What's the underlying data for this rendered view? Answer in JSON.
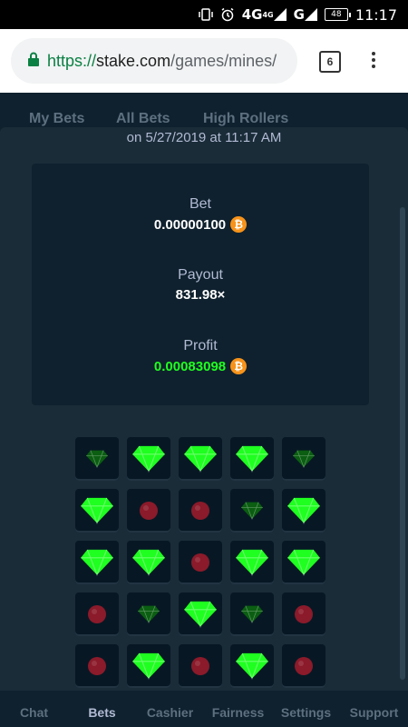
{
  "status_bar": {
    "network": "4G",
    "network_small": "4G",
    "carrier_network": "G",
    "battery": "48",
    "time": "11:17"
  },
  "browser": {
    "url_scheme": "https://",
    "url_host": "stake.com",
    "url_path": "/games/mines/",
    "tab_count": "6"
  },
  "background_tabs": [
    "My Bets",
    "All Bets",
    "High Rollers"
  ],
  "modal": {
    "date_line": "on 5/27/2019 at 11:17 AM",
    "bet_label": "Bet",
    "bet_value": "0.00000100",
    "payout_label": "Payout",
    "payout_value": "831.98×",
    "profit_label": "Profit",
    "profit_value": "0.00083098",
    "currency_symbol": "₿"
  },
  "grid": {
    "rows": [
      [
        "gem-dim",
        "gem",
        "gem",
        "gem",
        "gem-dim"
      ],
      [
        "gem",
        "mine",
        "mine",
        "gem-dim",
        "gem"
      ],
      [
        "gem",
        "gem",
        "mine",
        "gem",
        "gem"
      ],
      [
        "mine",
        "gem-dim",
        "gem",
        "gem-dim",
        "mine"
      ],
      [
        "mine",
        "gem",
        "mine",
        "gem",
        "mine"
      ]
    ]
  },
  "colors": {
    "gem": "#1fff20",
    "gem_dim": "#0b5e12",
    "mine": "#8b1a2a",
    "bitcoin": "#f7931a",
    "background": "#0f212e"
  },
  "bottom_nav": [
    "Chat",
    "Bets",
    "Cashier",
    "Fairness",
    "Settings",
    "Support"
  ],
  "bottom_nav_active": "Bets"
}
